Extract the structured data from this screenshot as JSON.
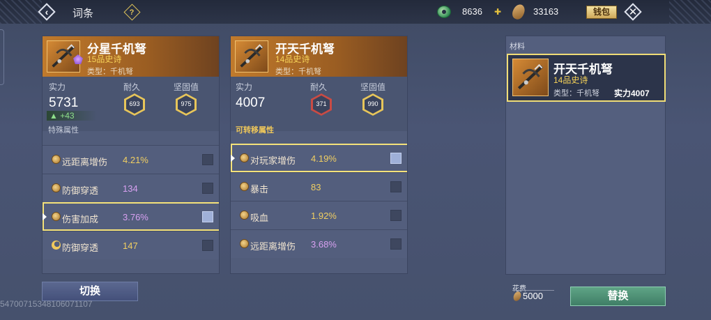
{
  "topbar": {
    "title": "词条",
    "help_label": "?",
    "currency_jade": "8636",
    "currency_coin": "33163",
    "wallet_label": "钱包"
  },
  "left_panel": {
    "name": "分星千机弩",
    "grade": "15品史诗",
    "type": "类型：千机弩",
    "power_label": "实力",
    "power": "5731",
    "power_increase": "+43",
    "durability_label": "耐久",
    "durability": "693",
    "solidity_label": "坚固值",
    "solidity": "975",
    "section_label": "特殊属性",
    "attributes": [
      {
        "name": "远距离增伤",
        "value": "4.21%"
      },
      {
        "name": "防御穿透",
        "value": "134"
      },
      {
        "name": "伤害加成",
        "value": "3.76%"
      },
      {
        "name": "防御穿透",
        "value": "147"
      }
    ]
  },
  "mid_panel": {
    "name": "开天千机弩",
    "grade": "14品史诗",
    "type": "类型：千机弩",
    "power_label": "实力",
    "power": "4007",
    "durability_label": "耐久",
    "durability": "371",
    "solidity_label": "坚固值",
    "solidity": "990",
    "section_label": "可转移属性",
    "attributes": [
      {
        "name": "对玩家增伤",
        "value": "4.19%"
      },
      {
        "name": "暴击",
        "value": "83"
      },
      {
        "name": "吸血",
        "value": "1.92%"
      },
      {
        "name": "远距离增伤",
        "value": "3.68%"
      }
    ]
  },
  "material_panel": {
    "label": "材料",
    "name": "开天千机弩",
    "grade": "14品史诗",
    "type": "类型：千机弩",
    "power": "实力4007"
  },
  "bottom": {
    "switch_label": "切换",
    "id_text": "5470071534810607110​7",
    "cost_label": "花费",
    "cost_value": "5000",
    "replace_label": "替换"
  },
  "colors": {
    "accent_gold": "#f1cf62",
    "selection_outline": "#f5e27a",
    "replace_green": "#5fa486"
  },
  "icons": [
    "back-icon",
    "help-icon",
    "jade-icon",
    "plus-icon",
    "coin-icon",
    "close-icon",
    "crossbow-icon"
  ]
}
